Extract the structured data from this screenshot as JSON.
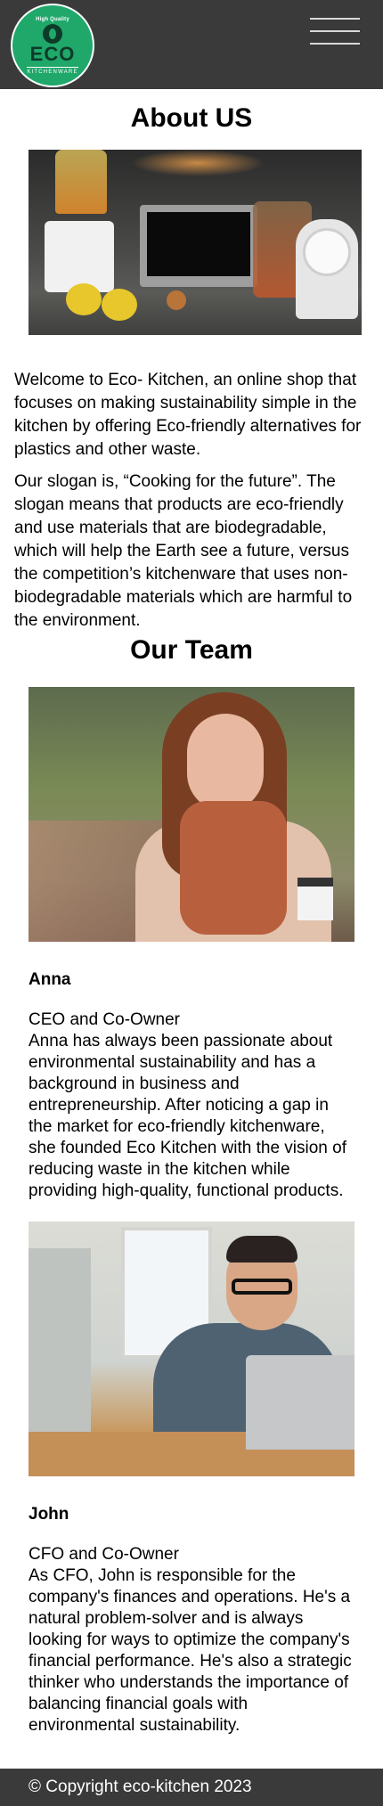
{
  "header": {
    "logo": {
      "top_text": "High Quality",
      "main_text": "ECO",
      "bottom_text": "KITCHENWARE"
    },
    "menu_icon": "hamburger-menu-icon"
  },
  "page_title": "About US",
  "hero_image_alt": "Kitchen countertop with blender, laptop, jars and a scale",
  "intro": {
    "paragraph1": "Welcome to Eco- Kitchen, an online shop that focuses on making sustainability simple in the kitchen by offering Eco-friendly alternatives for plastics and other waste.",
    "paragraph2": "Our slogan is, “Cooking for the future”. The slogan means that products are eco-friendly and use materials that are biodegradable, which will help the Earth see a future, versus the competition’s kitchenware that uses non-biodegradable materials which are harmful to the environment."
  },
  "team": {
    "title": "Our Team",
    "members": [
      {
        "name": "Anna",
        "role": "CEO and Co-Owner",
        "bio": "Anna has always been passionate about environmental sustainability and has a background in business and entrepreneurship. After noticing a gap in the market for eco-friendly kitchenware, she founded Eco Kitchen with the vision of reducing waste in the kitchen while providing high-quality, functional products."
      },
      {
        "name": "John",
        "role": "CFO and Co-Owner",
        "bio": "As CFO, John is responsible for the company's finances and operations. He's a natural problem-solver and is always looking for ways to optimize the company's financial performance. He's also a strategic thinker who understands the importance of balancing financial goals with environmental sustainability."
      }
    ]
  },
  "footer": {
    "copyright": "© Copyright eco-kitchen 2023"
  },
  "colors": {
    "header_bg": "#3a3a3a",
    "logo_green": "#1fa86a",
    "logo_dark": "#0d3b2a",
    "footer_bg": "#3a3a3a"
  }
}
